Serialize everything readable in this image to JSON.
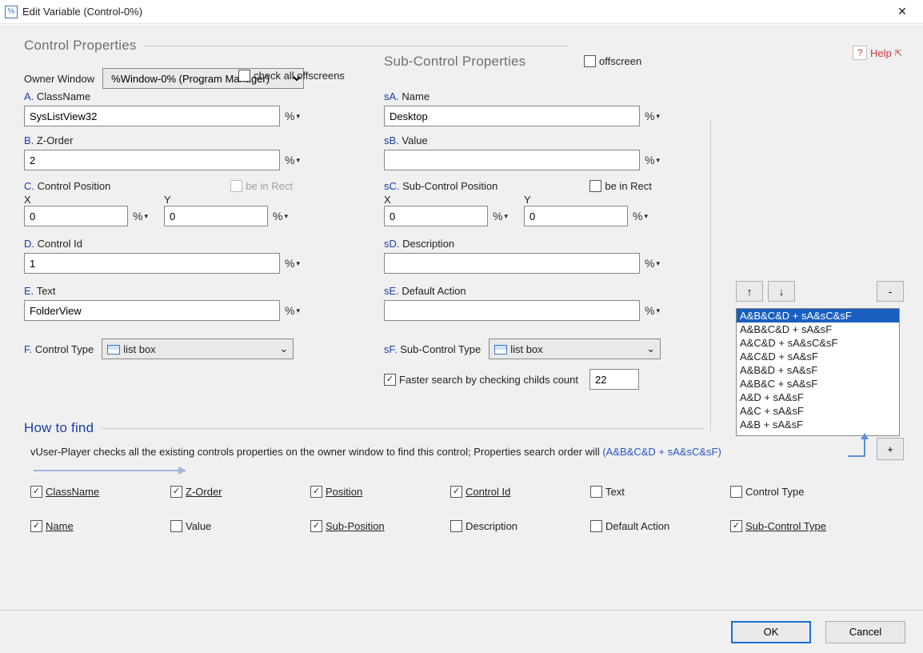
{
  "window": {
    "title": "Edit Variable (Control-0%)",
    "icon_text": "%"
  },
  "help": {
    "label": "Help",
    "popout": "⇱"
  },
  "sections": {
    "control_properties": "Control Properties",
    "sub_control_properties": "Sub-Control Properties",
    "how_to_find": "How to find"
  },
  "owner_window": {
    "label": "Owner Window",
    "value": "%Window-0% (Program Manager)"
  },
  "check_all_offscreens": {
    "label": "check all offscreens",
    "checked": false
  },
  "offscreen": {
    "label": "offscreen",
    "checked": false
  },
  "A": {
    "prefix": "A.",
    "label": "ClassName",
    "value": "SysListView32"
  },
  "B": {
    "prefix": "B.",
    "label": "Z-Order",
    "value": "2"
  },
  "C": {
    "prefix": "C.",
    "label": "Control Position",
    "be_in_rect": "be in Rect",
    "X_label": "X",
    "Y_label": "Y",
    "X": "0",
    "Y": "0"
  },
  "D": {
    "prefix": "D.",
    "label": "Control Id",
    "value": "1"
  },
  "E": {
    "prefix": "E.",
    "label": "Text",
    "value": "FolderView"
  },
  "F": {
    "prefix": "F.",
    "label": "Control Type",
    "value": "list box"
  },
  "sA": {
    "prefix": "sA.",
    "label": "Name",
    "value": "Desktop"
  },
  "sB": {
    "prefix": "sB.",
    "label": "Value",
    "value": ""
  },
  "sC": {
    "prefix": "sC.",
    "label": "Sub-Control Position",
    "be_in_rect": "be in Rect",
    "X_label": "X",
    "Y_label": "Y",
    "X": "0",
    "Y": "0"
  },
  "sD": {
    "prefix": "sD.",
    "label": "Description",
    "value": ""
  },
  "sE": {
    "prefix": "sE.",
    "label": "Default Action",
    "value": ""
  },
  "sF": {
    "prefix": "sF.",
    "label": "Sub-Control Type",
    "value": "list box"
  },
  "faster_search": {
    "label": "Faster search by checking childs count",
    "checked": true,
    "count": "22"
  },
  "howto_text": {
    "line1": "vUser-Player checks all the existing controls properties on the owner window to find this control; Properties search order will ",
    "formula": "(A&B&C&D + sA&sC&sF)"
  },
  "checks": {
    "ClassName": {
      "label": "ClassName",
      "checked": true
    },
    "ZOrder": {
      "label": "Z-Order",
      "checked": true
    },
    "Position": {
      "label": "Position",
      "checked": true
    },
    "ControlId": {
      "label": "Control Id",
      "checked": true
    },
    "Text": {
      "label": "Text",
      "checked": false
    },
    "ControlType": {
      "label": "Control Type",
      "checked": false
    },
    "Name": {
      "label": "Name",
      "checked": true
    },
    "Value": {
      "label": "Value",
      "checked": false
    },
    "SubPosition": {
      "label": "Sub-Position",
      "checked": true
    },
    "Description": {
      "label": "Description",
      "checked": false
    },
    "DefaultAction": {
      "label": "Default Action",
      "checked": false
    },
    "SubControlType": {
      "label": "Sub-Control Type",
      "checked": true
    }
  },
  "formula_list": {
    "selected": 0,
    "items": [
      "A&B&C&D + sA&sC&sF",
      "A&B&C&D + sA&sF",
      "A&C&D + sA&sC&sF",
      "A&C&D + sA&sF",
      "A&B&D + sA&sF",
      "A&B&C + sA&sF",
      "A&D + sA&sF",
      "A&C + sA&sF",
      "A&B + sA&sF"
    ]
  },
  "buttons": {
    "up": "↑",
    "down": "↓",
    "minus": "-",
    "plus": "+",
    "ok": "OK",
    "cancel": "Cancel"
  },
  "glyphs": {
    "check": "✓",
    "caret": "▾",
    "close": "✕",
    "dropdown": "⌄"
  }
}
